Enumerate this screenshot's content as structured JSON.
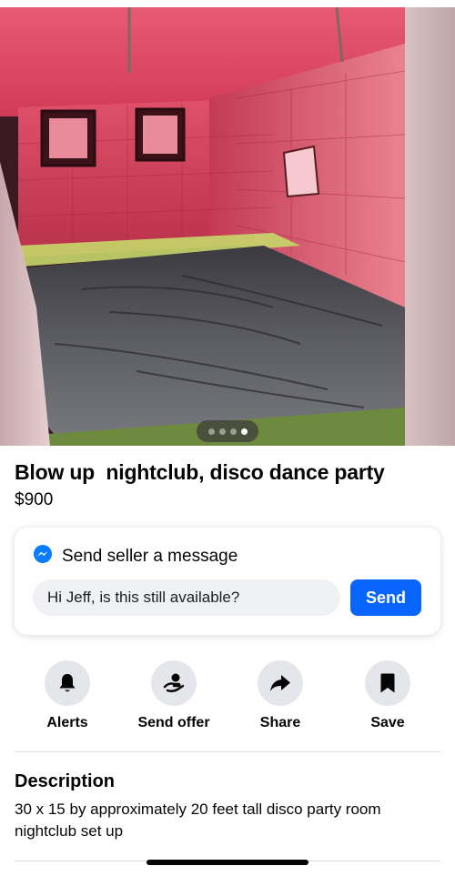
{
  "listing": {
    "title": "Blow up  nightclub, disco dance party",
    "price": "$900",
    "photo_count": 4,
    "active_photo_index": 3
  },
  "message": {
    "header_icon": "messenger-icon",
    "header": "Send seller a message",
    "input_value": "Hi Jeff, is this still available?",
    "send_label": "Send"
  },
  "actions": [
    {
      "icon": "bell-icon",
      "label": "Alerts"
    },
    {
      "icon": "send-offer-icon",
      "label": "Send offer"
    },
    {
      "icon": "share-arrow-icon",
      "label": "Share"
    },
    {
      "icon": "bookmark-icon",
      "label": "Save"
    }
  ],
  "description": {
    "heading": "Description",
    "text": "30 x 15 by approximately 20 feet tall disco party room nightclub set up"
  },
  "colors": {
    "accent": "#0866ff",
    "action_circle": "#e4e6eb"
  }
}
